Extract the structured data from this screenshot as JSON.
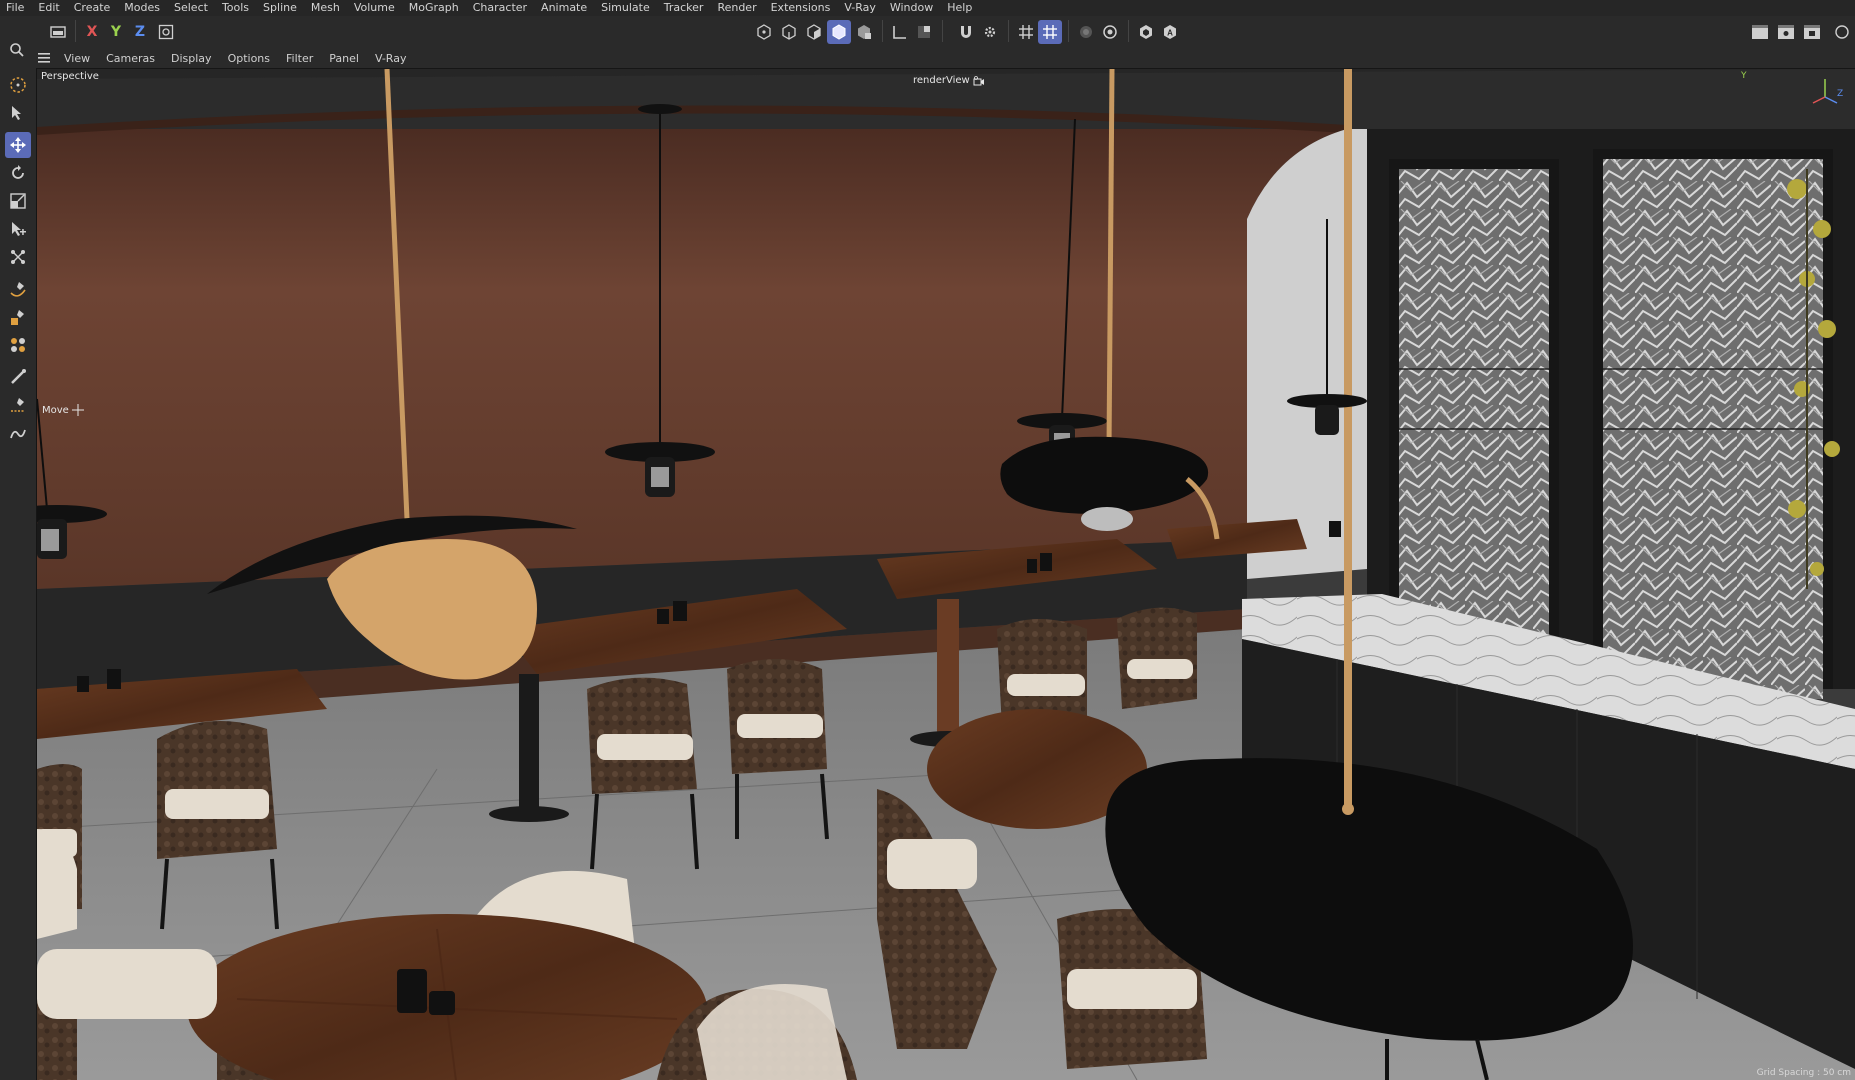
{
  "menubar": {
    "items": [
      "File",
      "Edit",
      "Create",
      "Modes",
      "Select",
      "Tools",
      "Spline",
      "Mesh",
      "Volume",
      "MoGraph",
      "Character",
      "Animate",
      "Simulate",
      "Tracker",
      "Render",
      "Extensions",
      "V-Ray",
      "Window",
      "Help"
    ]
  },
  "toolbar": {
    "axis_x": "X",
    "axis_y": "Y",
    "axis_z": "Z",
    "axis_colors": {
      "x": "#e05555",
      "y": "#9bd24e",
      "z": "#5b8df0"
    }
  },
  "viewmenu": {
    "items": [
      "View",
      "Cameras",
      "Display",
      "Options",
      "Filter",
      "Panel",
      "V-Ray"
    ]
  },
  "viewport": {
    "perspective_label": "Perspective",
    "camera_label": "renderView",
    "tool_label": "Move",
    "grid_spacing": "Grid Spacing : 50 cm",
    "gizmo_y": "Y",
    "gizmo_z": "Z"
  },
  "colors": {
    "accent": "#5b6bb8",
    "wall": "#6e4434",
    "floor": "#8c8c8c",
    "wood": "#5a3420",
    "lamp_tan": "#c8a070"
  }
}
